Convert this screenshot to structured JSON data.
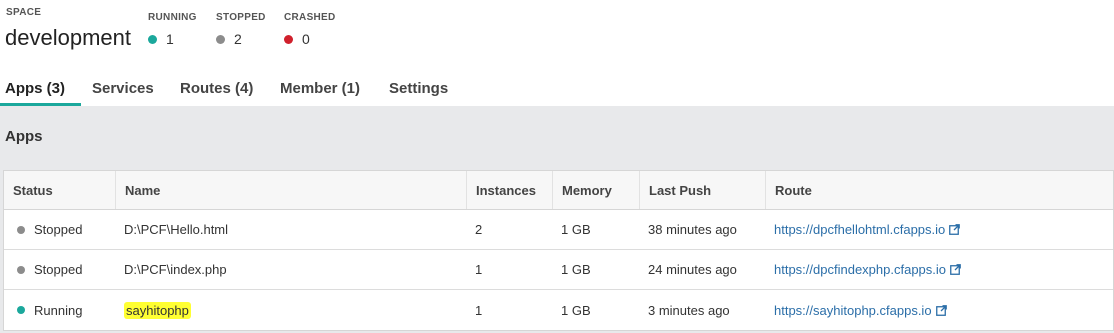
{
  "space": {
    "label": "SPACE",
    "name": "development"
  },
  "stats": [
    {
      "label": "RUNNING",
      "value": "1",
      "color": "#1ba89c"
    },
    {
      "label": "STOPPED",
      "value": "2",
      "color": "#8c8c8c"
    },
    {
      "label": "CRASHED",
      "value": "0",
      "color": "#d0202c"
    }
  ],
  "tabs": [
    {
      "label": "Apps (3)",
      "active": true
    },
    {
      "label": "Services",
      "active": false
    },
    {
      "label": "Routes (4)",
      "active": false
    },
    {
      "label": "Member (1)",
      "active": false
    },
    {
      "label": "Settings",
      "active": false
    }
  ],
  "panel": {
    "title": "Apps"
  },
  "table": {
    "headers": {
      "status": "Status",
      "name": "Name",
      "instances": "Instances",
      "memory": "Memory",
      "last_push": "Last Push",
      "route": "Route"
    },
    "rows": [
      {
        "status": "Stopped",
        "status_color": "#8c8c8c",
        "name": "D:\\PCF\\Hello.html",
        "instances": "2",
        "memory": "1 GB",
        "last_push": "38 minutes ago",
        "route": "https://dpcfhellohtml.cfapps.io"
      },
      {
        "status": "Stopped",
        "status_color": "#8c8c8c",
        "name": "D:\\PCF\\index.php",
        "instances": "1",
        "memory": "1 GB",
        "last_push": "24 minutes ago",
        "route": "https://dpcfindexphp.cfapps.io"
      },
      {
        "status": "Running",
        "status_color": "#1ba89c",
        "name": "sayhitophp",
        "instances": "1",
        "memory": "1 GB",
        "last_push": "3 minutes ago",
        "route": "https://sayhitophp.cfapps.io"
      }
    ]
  },
  "icons": {
    "external_link": "external-link-icon"
  }
}
